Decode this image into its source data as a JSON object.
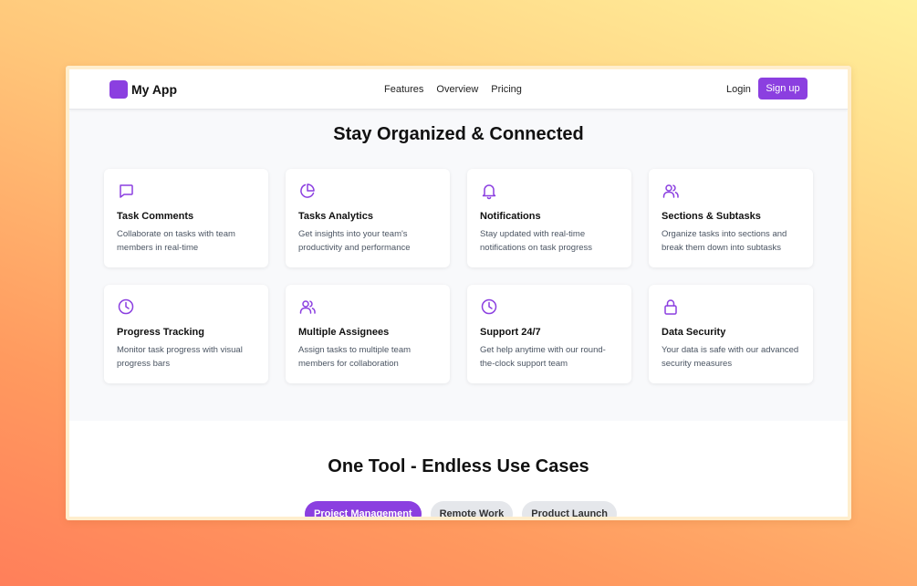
{
  "colors": {
    "accent": "#8b3fe0",
    "section_bg": "#f8f9fb"
  },
  "nav": {
    "brand": "My App",
    "links": [
      "Features",
      "Overview",
      "Pricing"
    ],
    "login": "Login",
    "signup": "Sign up"
  },
  "features": {
    "title": "Stay Organized & Connected",
    "cards": [
      {
        "icon": "message-icon",
        "title": "Task Comments",
        "desc": "Collaborate on tasks with team members in real-time"
      },
      {
        "icon": "pie-chart-icon",
        "title": "Tasks Analytics",
        "desc": "Get insights into your team's productivity and performance"
      },
      {
        "icon": "bell-icon",
        "title": "Notifications",
        "desc": "Stay updated with real-time notifications on task progress"
      },
      {
        "icon": "users-icon",
        "title": "Sections & Subtasks",
        "desc": "Organize tasks into sections and break them down into subtasks"
      },
      {
        "icon": "clock-icon",
        "title": "Progress Tracking",
        "desc": "Monitor task progress with visual progress bars"
      },
      {
        "icon": "users-icon",
        "title": "Multiple Assignees",
        "desc": "Assign tasks to multiple team members for collaboration"
      },
      {
        "icon": "clock-icon",
        "title": "Support 24/7",
        "desc": "Get help anytime with our round-the-clock support team"
      },
      {
        "icon": "lock-icon",
        "title": "Data Security",
        "desc": "Your data is safe with our advanced security measures"
      }
    ]
  },
  "usecases": {
    "title": "One Tool - Endless Use Cases",
    "tabs": [
      "Project Management",
      "Remote Work",
      "Product Launch"
    ]
  }
}
